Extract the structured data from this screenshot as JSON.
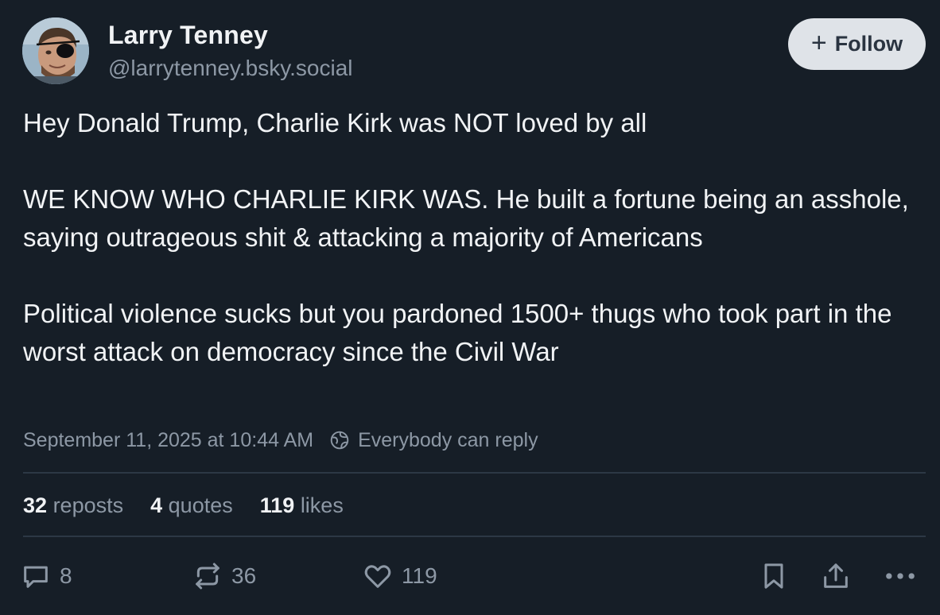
{
  "author": {
    "display_name": "Larry Tenney",
    "handle": "@larrytenney.bsky.social"
  },
  "follow_button": {
    "label": "Follow"
  },
  "post": {
    "paragraphs": [
      "Hey Donald Trump, Charlie Kirk was NOT loved by all",
      "WE KNOW WHO CHARLIE KIRK WAS. He built a fortune being an asshole, saying outrageous shit & attacking a majority of Americans",
      "Political violence sucks but you pardoned 1500+ thugs who took part in the worst attack on democracy since the Civil War"
    ],
    "timestamp": "September 11, 2025 at 10:44 AM",
    "reply_setting": "Everybody can reply"
  },
  "stats": {
    "reposts": {
      "count": "32",
      "label": "reposts"
    },
    "quotes": {
      "count": "4",
      "label": "quotes"
    },
    "likes": {
      "count": "119",
      "label": "likes"
    }
  },
  "actions": {
    "reply_count": "8",
    "repost_count": "36",
    "like_count": "119",
    "icons": [
      "reply-icon",
      "repost-icon",
      "like-icon",
      "bookmark-icon",
      "share-icon",
      "more-icon"
    ]
  },
  "colors": {
    "background": "#161e27",
    "text_primary": "#f1f3f5",
    "text_secondary": "#8d98a5",
    "divider": "#2c3845",
    "follow_button_bg": "#dfe3e8",
    "follow_button_text": "#2a3441"
  }
}
